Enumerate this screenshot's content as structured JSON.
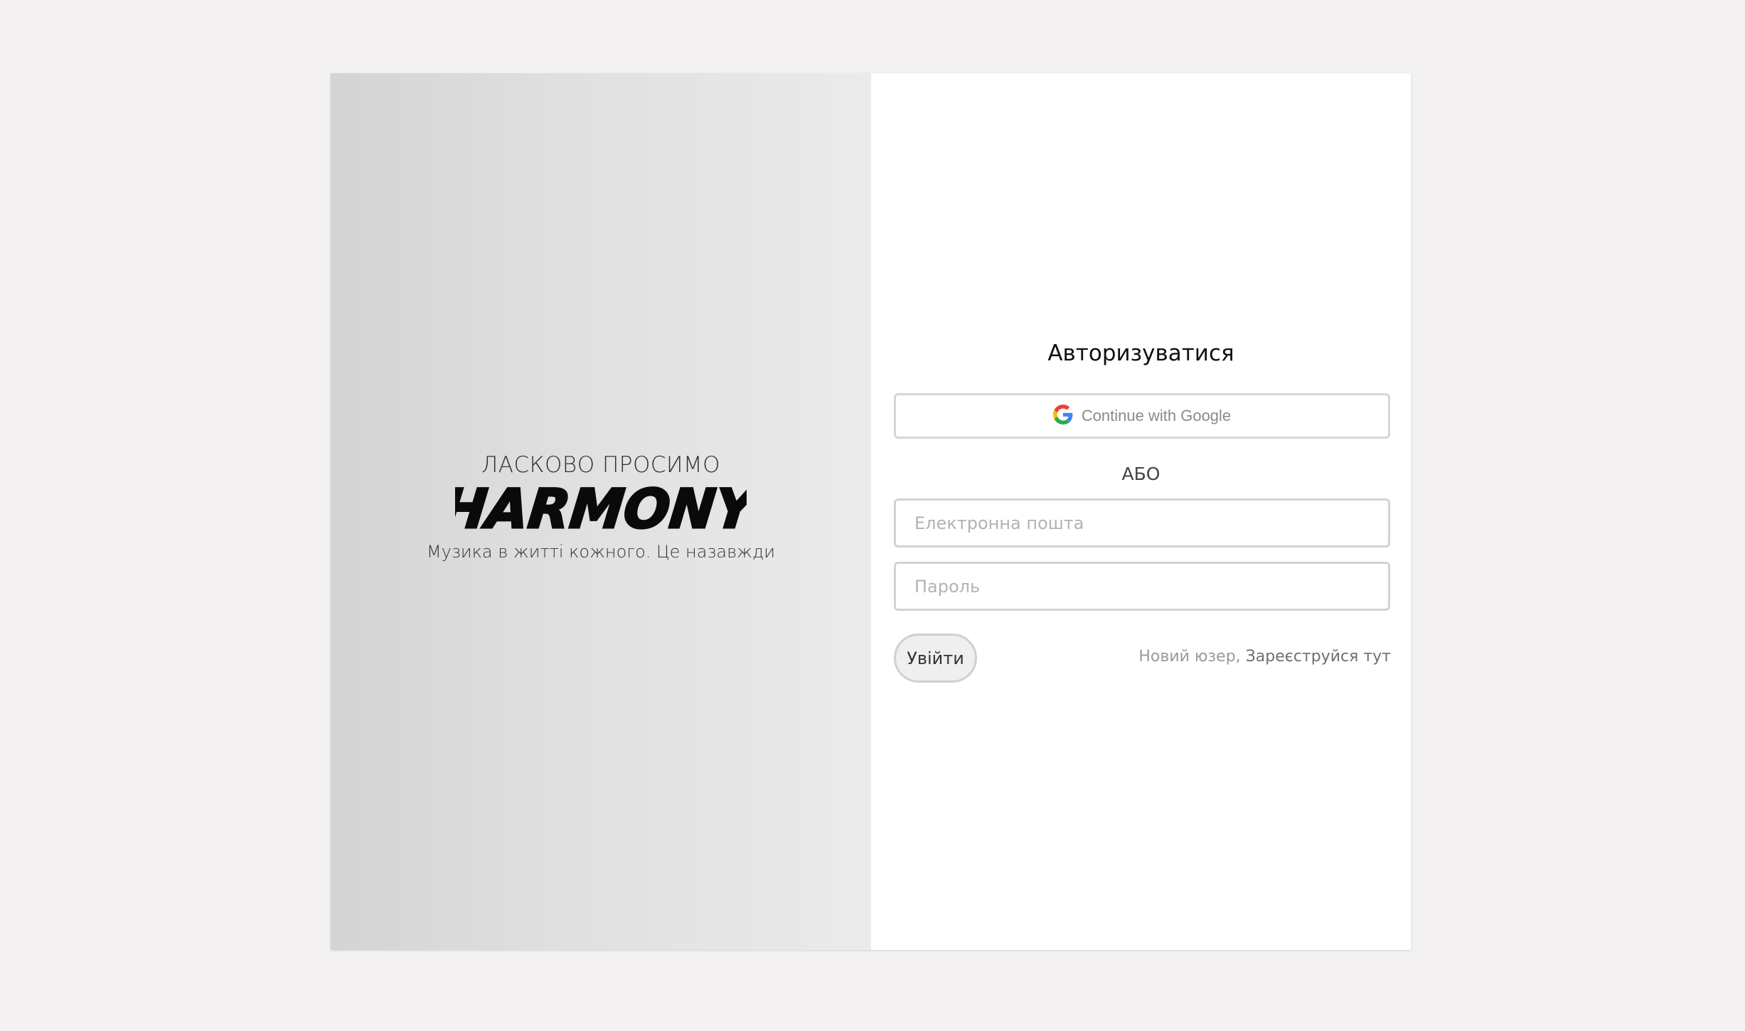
{
  "hero": {
    "welcome": "ЛАСКОВО ПРОСИМО",
    "brand": "HARMONY",
    "tagline": "Музика в житті кожного. Це назавжди"
  },
  "auth": {
    "title": "Авторизуватися",
    "google_label": "Continue with Google",
    "or_label": "АБО",
    "email_placeholder": "Електронна пошта",
    "password_placeholder": "Пароль",
    "login_label": "Увійти",
    "new_user_text": "Новий юзер,",
    "register_link": "Зареєструйся тут"
  },
  "colors": {
    "page_bg": "#f3f1f2",
    "panel_left_start": "#d4d4d4",
    "panel_left_end": "#ebebeb",
    "panel_right": "#ffffff"
  },
  "icons": {
    "google": "google-g-logo-icon"
  }
}
